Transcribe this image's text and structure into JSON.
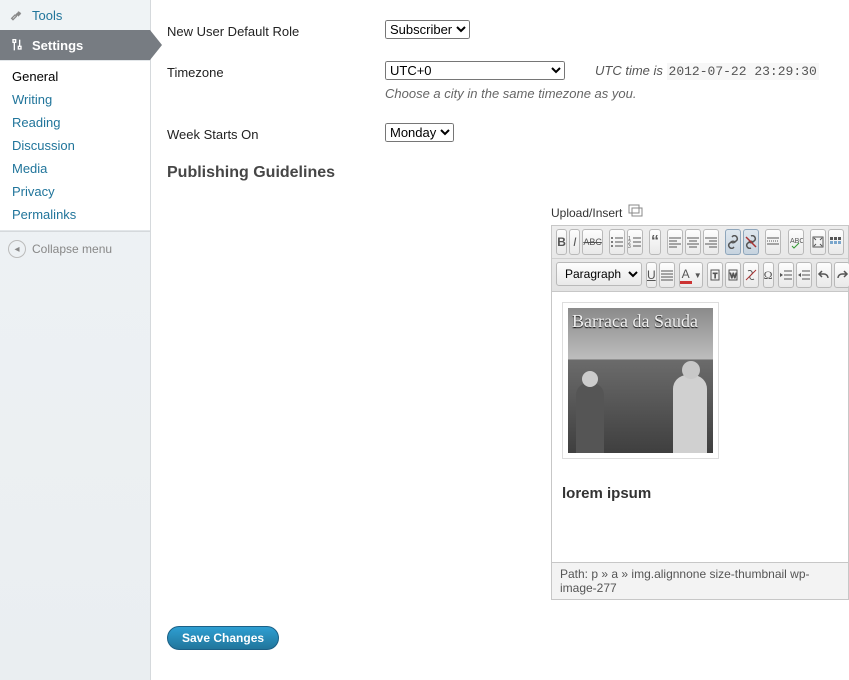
{
  "sidebar": {
    "tools_label": "Tools",
    "settings_label": "Settings",
    "submenu": {
      "general": "General",
      "writing": "Writing",
      "reading": "Reading",
      "discussion": "Discussion",
      "media": "Media",
      "privacy": "Privacy",
      "permalinks": "Permalinks"
    },
    "collapse_label": "Collapse menu"
  },
  "form": {
    "new_user_role_label": "New User Default Role",
    "new_user_role_value": "Subscriber",
    "timezone_label": "Timezone",
    "timezone_value": "UTC+0",
    "utc_prefix": "UTC time is",
    "utc_value": "2012-07-22 23:29:30",
    "timezone_hint": "Choose a city in the same timezone as you.",
    "week_start_label": "Week Starts On",
    "week_start_value": "Monday"
  },
  "section": {
    "publishing_label": "Publishing Guidelines",
    "upload_insert_label": "Upload/Insert"
  },
  "editor": {
    "format_value": "Paragraph",
    "caption": "lorem ipsum",
    "image_text": "Barraca da Sauda",
    "path_label": "Path:",
    "path_value": "p » a » img.alignnone size-thumbnail wp-image-277"
  },
  "save": {
    "label": "Save Changes"
  }
}
